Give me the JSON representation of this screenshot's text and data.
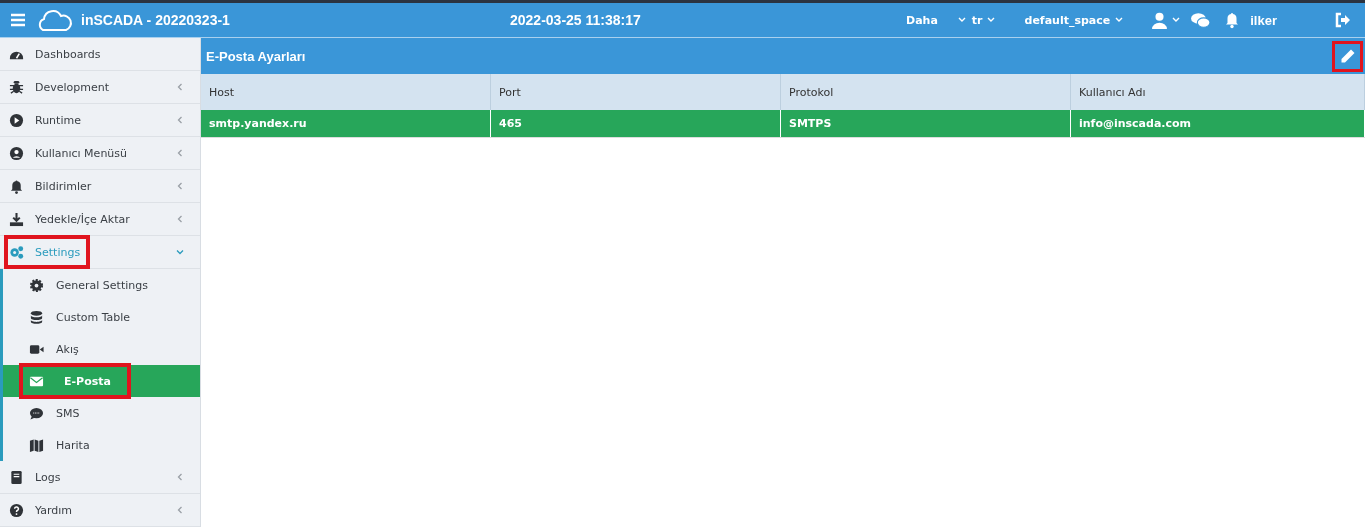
{
  "topbar": {
    "title": "inSCADA - 20220323-1",
    "datetime": "2022-03-25 11:38:17",
    "more": "Daha",
    "language": "tr",
    "space": "default_space",
    "user": "ilker"
  },
  "sidebar": {
    "items": [
      {
        "label": "Dashboards",
        "selected": false,
        "highlighted": false
      },
      {
        "label": "Development",
        "expanded": false,
        "selected": false,
        "highlighted": false
      },
      {
        "label": "Runtime",
        "expanded": false,
        "selected": false,
        "highlighted": false
      },
      {
        "label": "Kullanıcı Menüsü",
        "expanded": false,
        "selected": false,
        "highlighted": false
      },
      {
        "label": "Bildirimler",
        "expanded": false,
        "selected": false,
        "highlighted": false
      },
      {
        "label": "Yedekle/İçe Aktar",
        "expanded": false,
        "selected": false,
        "highlighted": false
      },
      {
        "label": "Settings",
        "expanded": true,
        "selected": false,
        "highlighted": true,
        "children": [
          {
            "label": "General Settings",
            "selected": false,
            "highlighted": false
          },
          {
            "label": "Custom Table",
            "selected": false,
            "highlighted": false
          },
          {
            "label": "Akış",
            "selected": false,
            "highlighted": false
          },
          {
            "label": "E-Posta",
            "selected": true,
            "highlighted": true
          },
          {
            "label": "SMS",
            "selected": false,
            "highlighted": false
          },
          {
            "label": "Harita",
            "selected": false,
            "highlighted": false
          }
        ]
      },
      {
        "label": "Logs",
        "expanded": false,
        "selected": false,
        "highlighted": false
      },
      {
        "label": "Yardım",
        "expanded": false,
        "selected": false,
        "highlighted": false
      }
    ]
  },
  "panel": {
    "title": "E-Posta Ayarları",
    "edit_highlighted": true
  },
  "table": {
    "columns": [
      "Host",
      "Port",
      "Protokol",
      "Kullanıcı Adı"
    ],
    "rows": [
      {
        "selected": true,
        "cells": [
          "smtp.yandex.ru",
          "465",
          "SMTPS",
          "info@inscada.com"
        ]
      }
    ]
  }
}
